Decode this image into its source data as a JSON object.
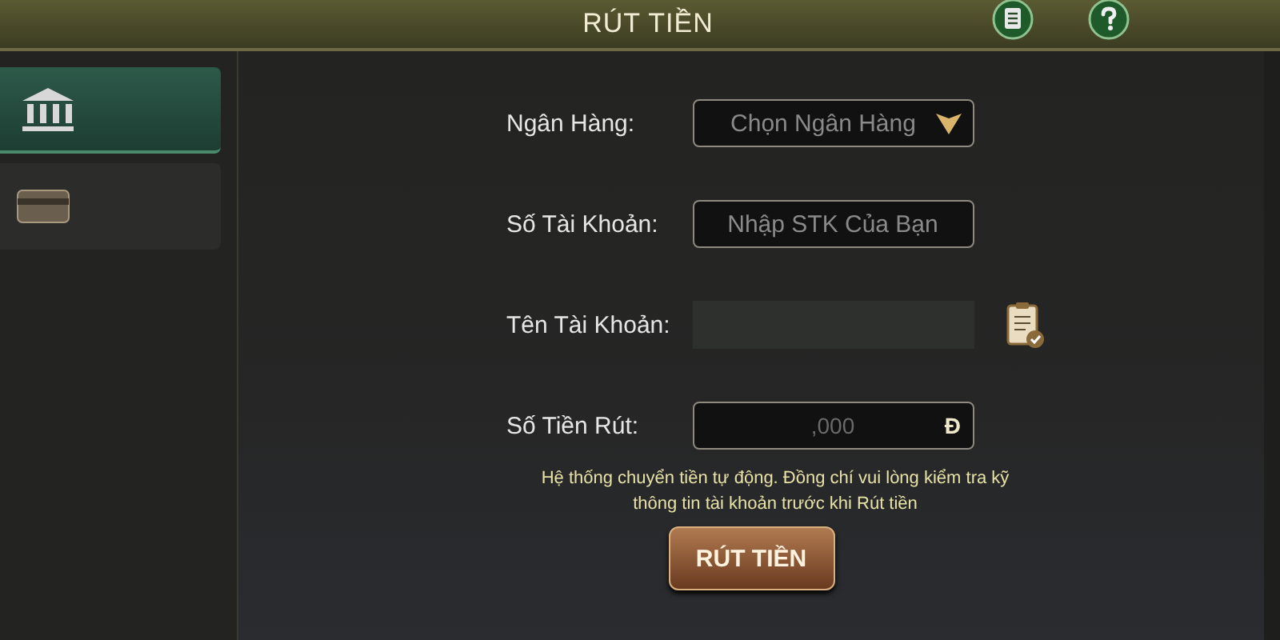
{
  "header": {
    "title": "RÚT TIỀN"
  },
  "sidebar": {
    "items": [
      {
        "kind": "bank",
        "selected": true
      },
      {
        "kind": "card",
        "selected": false
      }
    ]
  },
  "form": {
    "fields": [
      {
        "label": "Ngân Hàng:",
        "kind": "dropdown",
        "placeholder": "Chọn Ngân Hàng"
      },
      {
        "label": "Số Tài Khoản:",
        "kind": "input",
        "placeholder": "Nhập STK Của Bạn"
      },
      {
        "label": "Tên Tài Khoản:",
        "kind": "readonly"
      },
      {
        "label": "Số Tiền Rút:",
        "kind": "amount",
        "placeholder": ",000",
        "suffix": "Đ"
      }
    ],
    "note": "Hệ thống chuyển tiền tự động. Đồng chí vui lòng kiểm tra kỹ thông tin tài khoản trước khi Rút tiền",
    "submit": "RÚT TIỀN"
  }
}
